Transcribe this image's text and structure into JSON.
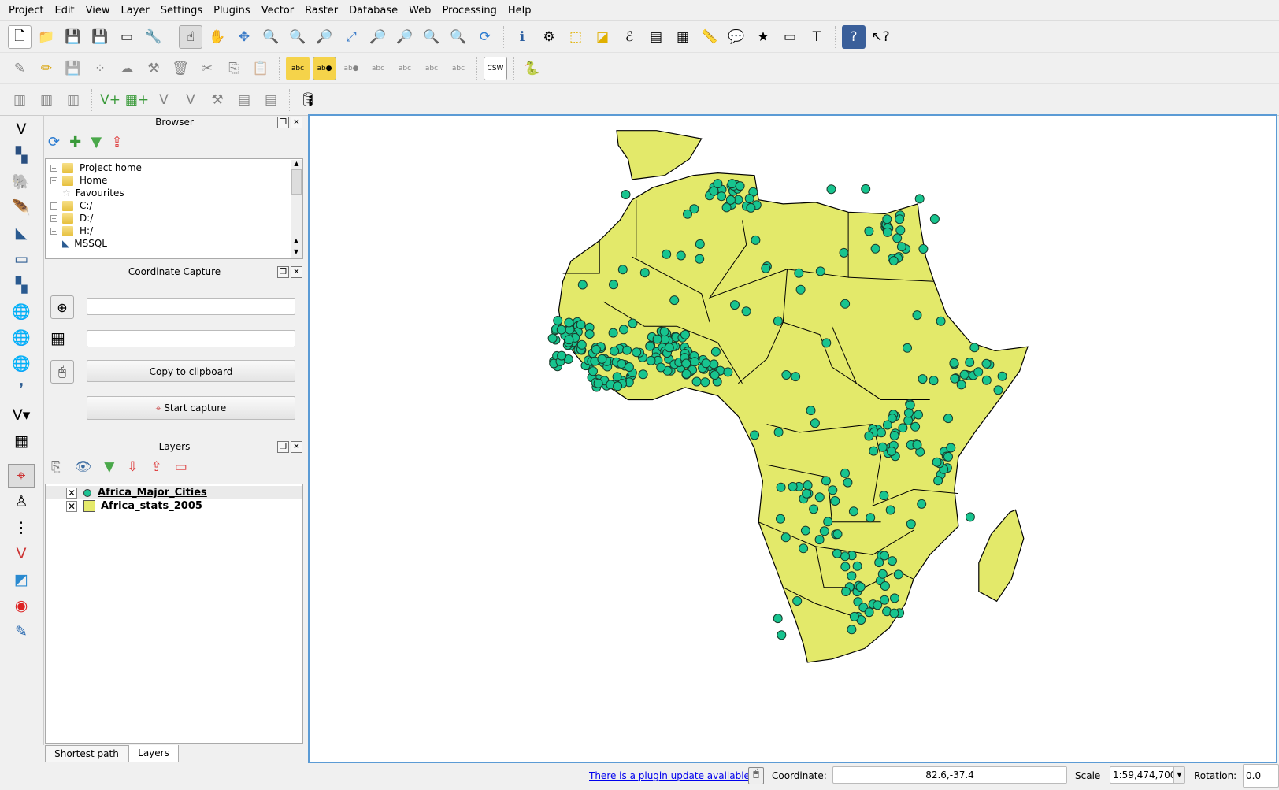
{
  "menu": [
    "Project",
    "Edit",
    "View",
    "Layer",
    "Settings",
    "Plugins",
    "Vector",
    "Raster",
    "Database",
    "Web",
    "Processing",
    "Help"
  ],
  "browser": {
    "title": "Browser",
    "items": [
      {
        "label": "Project home"
      },
      {
        "label": "Home"
      },
      {
        "label": "Favourites"
      },
      {
        "label": "C:/"
      },
      {
        "label": "D:/"
      },
      {
        "label": "H:/"
      },
      {
        "label": "MSSQL"
      }
    ]
  },
  "coord_capture": {
    "title": "Coordinate Capture",
    "field1": "",
    "field2": "",
    "copy_label": "Copy to clipboard",
    "start_label": "Start capture"
  },
  "layers": {
    "title": "Layers",
    "items": [
      {
        "label": "Africa_Major_Cities",
        "visible": true,
        "symbol": "circle",
        "color": "#1dc394"
      },
      {
        "label": "Africa_stats_2005",
        "visible": true,
        "symbol": "square",
        "color": "#e5ea6b"
      }
    ]
  },
  "tabs": [
    "Shortest path",
    "Layers"
  ],
  "status": {
    "plugin_update": "There is a plugin update available",
    "coordinate_label": "Coordinate:",
    "coordinate": "82.6,-37.4",
    "scale_label": "Scale",
    "scale": "1:59,474,700",
    "rotation_label": "Rotation:",
    "rotation": "0.0"
  },
  "map": {
    "land_color": "#e3e96a",
    "city_color": "#17c48f",
    "border_color": "#000000"
  }
}
